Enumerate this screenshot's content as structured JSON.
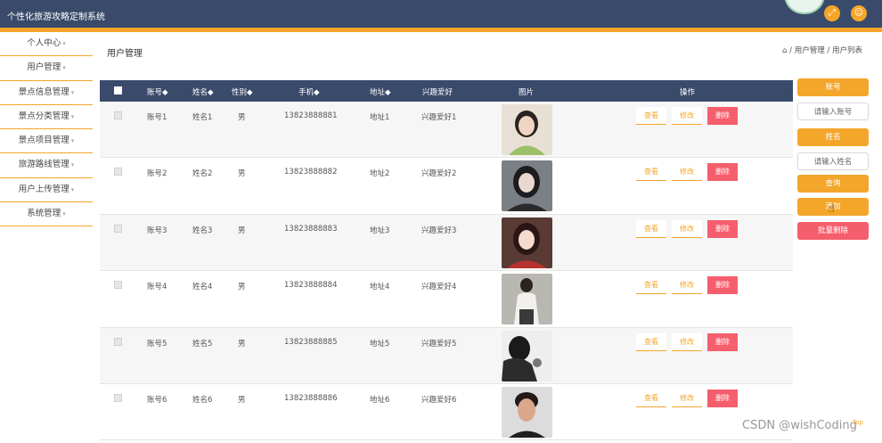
{
  "header": {
    "title": "个性化旅游攻略定制系统",
    "fullscreen_icon": "fullscreen-icon",
    "user_icon": "user-icon"
  },
  "sidebar": {
    "items": [
      {
        "label": "个人中心"
      },
      {
        "label": "用户管理"
      },
      {
        "label": "景点信息管理"
      },
      {
        "label": "景点分类管理"
      },
      {
        "label": "景点项目管理"
      },
      {
        "label": "旅游路线管理"
      },
      {
        "label": "用户上传管理"
      },
      {
        "label": "系统管理"
      }
    ],
    "caret": "▾"
  },
  "main": {
    "title": "用户管理",
    "breadcrumb": "⌂ / 用户管理 / 用户列表"
  },
  "table": {
    "columns": [
      "账号◆",
      "姓名◆",
      "性别◆",
      "手机◆",
      "地址◆",
      "兴趣爱好",
      "图片",
      "操作"
    ],
    "rows": [
      {
        "account": "账号1",
        "name": "姓名1",
        "gender": "男",
        "phone": "13823888881",
        "address": "地址1",
        "hobby": "兴趣爱好1"
      },
      {
        "account": "账号2",
        "name": "姓名2",
        "gender": "男",
        "phone": "13823888882",
        "address": "地址2",
        "hobby": "兴趣爱好2"
      },
      {
        "account": "账号3",
        "name": "姓名3",
        "gender": "男",
        "phone": "13823888883",
        "address": "地址3",
        "hobby": "兴趣爱好3"
      },
      {
        "account": "账号4",
        "name": "姓名4",
        "gender": "男",
        "phone": "13823888884",
        "address": "地址4",
        "hobby": "兴趣爱好4"
      },
      {
        "account": "账号5",
        "name": "姓名5",
        "gender": "男",
        "phone": "13823888885",
        "address": "地址5",
        "hobby": "兴趣爱好5"
      },
      {
        "account": "账号6",
        "name": "姓名6",
        "gender": "男",
        "phone": "13823888886",
        "address": "地址6",
        "hobby": "兴趣爱好6"
      }
    ],
    "actions": {
      "view": "查看",
      "edit": "修改",
      "delete": "删除"
    }
  },
  "panel": {
    "account_label": "账号",
    "account_placeholder": "请输入账号",
    "name_label": "姓名",
    "name_placeholder": "请输入姓名",
    "search": "查询",
    "add": "添加",
    "batch_delete": "批量删除"
  },
  "footer": {
    "watermark": "CSDN @wishCoding",
    "top_link": "Top"
  },
  "colors": {
    "header": "#3a4a6b",
    "accent": "#f4a62a",
    "danger": "#f55e6c"
  }
}
